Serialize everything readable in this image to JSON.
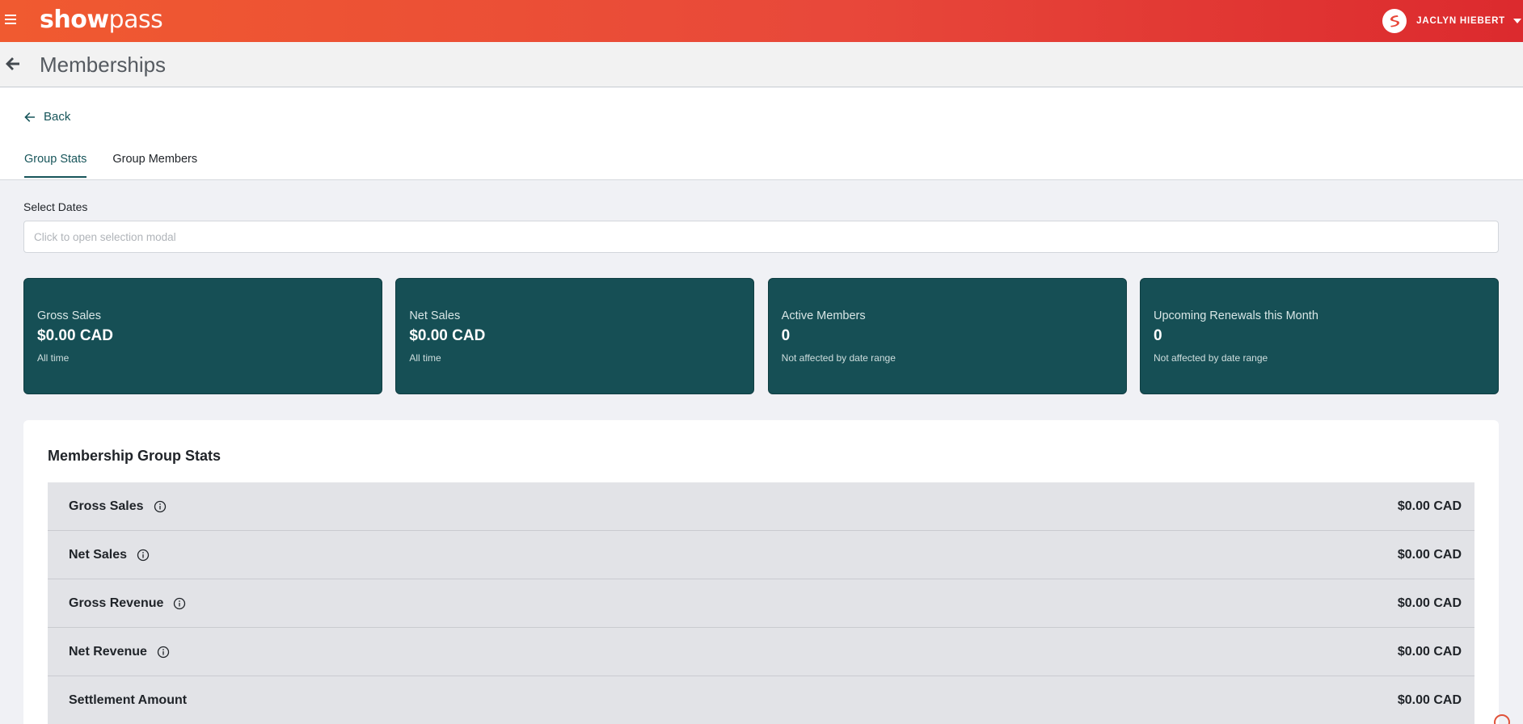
{
  "topbar": {
    "logo_bold": "show",
    "logo_light": "pass",
    "user_name": "JACLYN HIEBERT",
    "accent_color": "#e8483a"
  },
  "header": {
    "title": "Memberships"
  },
  "nav": {
    "back_label": "Back",
    "tabs": [
      {
        "label": "Group Stats",
        "active": true
      },
      {
        "label": "Group Members",
        "active": false
      }
    ]
  },
  "filters": {
    "select_dates_label": "Select Dates",
    "select_dates_placeholder": "Click to open selection modal"
  },
  "cards": [
    {
      "label": "Gross Sales",
      "value": "$0.00 CAD",
      "sub": "All time"
    },
    {
      "label": "Net Sales",
      "value": "$0.00 CAD",
      "sub": "All time"
    },
    {
      "label": "Active Members",
      "value": "0",
      "sub": "Not affected by date range"
    },
    {
      "label": "Upcoming Renewals this Month",
      "value": "0",
      "sub": "Not affected by date range"
    }
  ],
  "stats": {
    "title": "Membership Group Stats",
    "rows": [
      {
        "label": "Gross Sales",
        "value": "$0.00 CAD",
        "info": true
      },
      {
        "label": "Net Sales",
        "value": "$0.00 CAD",
        "info": true
      },
      {
        "label": "Gross Revenue",
        "value": "$0.00 CAD",
        "info": true
      },
      {
        "label": "Net Revenue",
        "value": "$0.00 CAD",
        "info": true
      },
      {
        "label": "Settlement Amount",
        "value": "$0.00 CAD",
        "info": false
      }
    ]
  },
  "colors": {
    "card_bg": "#164f55",
    "link": "#17555a"
  }
}
